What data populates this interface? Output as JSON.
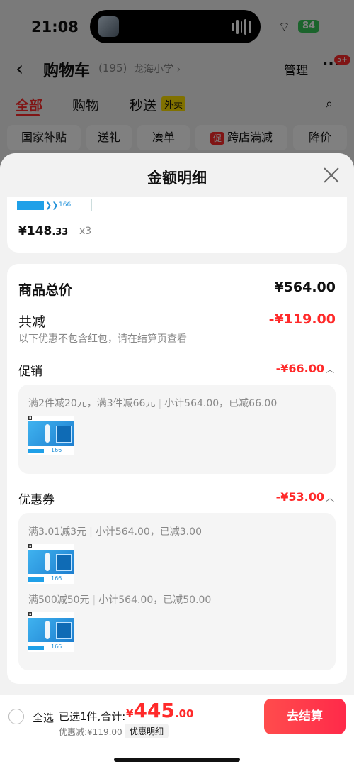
{
  "status": {
    "time": "21:08",
    "battery": "84"
  },
  "nav": {
    "back": "‹",
    "title": "购物车",
    "count": "(195)",
    "location": "龙海小学 ›",
    "manage": "管理",
    "more": "···",
    "badge": "5+"
  },
  "tabs": {
    "all": "全部",
    "shopping": "购物",
    "flash": "秒送",
    "waimai": "外卖"
  },
  "chips": {
    "subsidy": "国家补贴",
    "gift": "送礼",
    "bundle": "凑单",
    "cross_store_icon": "促",
    "cross_store": "跨店满减",
    "price_drop": "降价"
  },
  "sheet": {
    "title": "金额明细",
    "item": {
      "price_main": "¥148",
      "price_dec": ".33",
      "qty": "x3",
      "strip_price": "166"
    },
    "total_label": "商品总价",
    "total_value": "¥564.00",
    "reduce_label": "共减",
    "reduce_value": "-¥119.00",
    "note": "以下优惠不包含红包，请在结算页查看",
    "promo": {
      "label": "促销",
      "value": "-¥66.00",
      "rule": "满2件减20元，满3件减66元",
      "summary": "小计564.00，已减66.00"
    },
    "coupon": {
      "label": "优惠券",
      "value": "-¥53.00",
      "rule1": "满3.01减3元",
      "summary1": "小计564.00，已减3.00",
      "rule2": "满500减50元",
      "summary2": "小计564.00，已减50.00"
    },
    "thumb_price": "166"
  },
  "bottom": {
    "select_all": "全选",
    "selected": "已选1件,合计:",
    "currency": "¥",
    "total_int": "445",
    "total_dec": ".00",
    "saved": "优惠减:¥119.00",
    "detail": "优惠明细",
    "checkout": "去结算"
  }
}
